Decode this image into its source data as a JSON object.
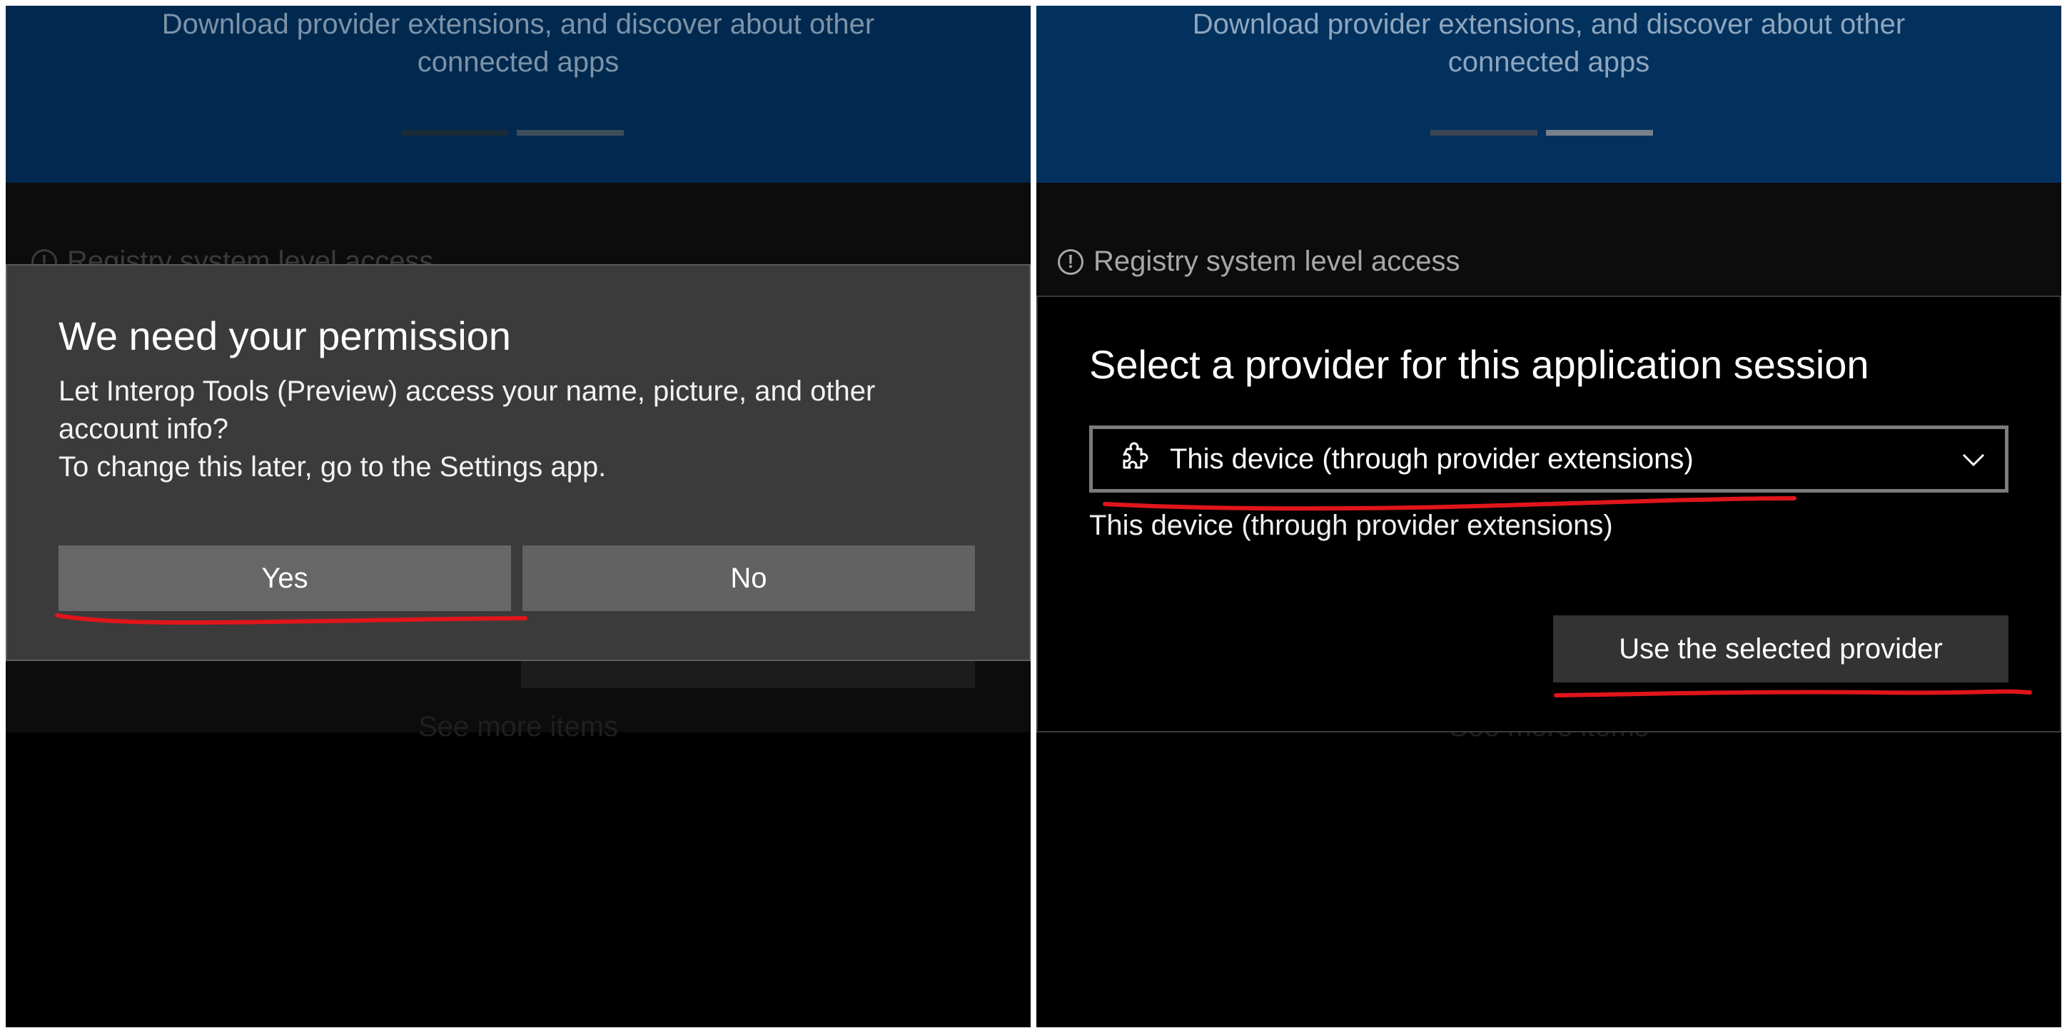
{
  "left_screen": {
    "header": {
      "line1": "Download provider extensions, and discover about other",
      "line2": "connected apps"
    },
    "background_item": "Registry system level access",
    "background_see_more": "See more items",
    "permission_dialog": {
      "title": "We need your permission",
      "body_line1": "Let Interop Tools (Preview) access your name, picture, and other",
      "body_line2": "account info?",
      "body_line3": "To change this later, go to the Settings app.",
      "yes_label": "Yes",
      "no_label": "No"
    }
  },
  "right_screen": {
    "header": {
      "line1": "Download provider extensions, and discover about other",
      "line2": "connected apps"
    },
    "background_item": "Registry system level access",
    "background_see_more": "See more items",
    "provider_dialog": {
      "title": "Select a provider for this application session",
      "combo_value": "This device (through provider extensions)",
      "combo_icon": "puzzle-icon",
      "selected_text": "This device (through provider extensions)",
      "use_button_label": "Use the selected provider"
    }
  },
  "colors": {
    "annotation_ink": "#e0151c",
    "dialog_bg": "#3b3b3b",
    "button_bg": "#676767",
    "header_blue": "#03315e"
  }
}
